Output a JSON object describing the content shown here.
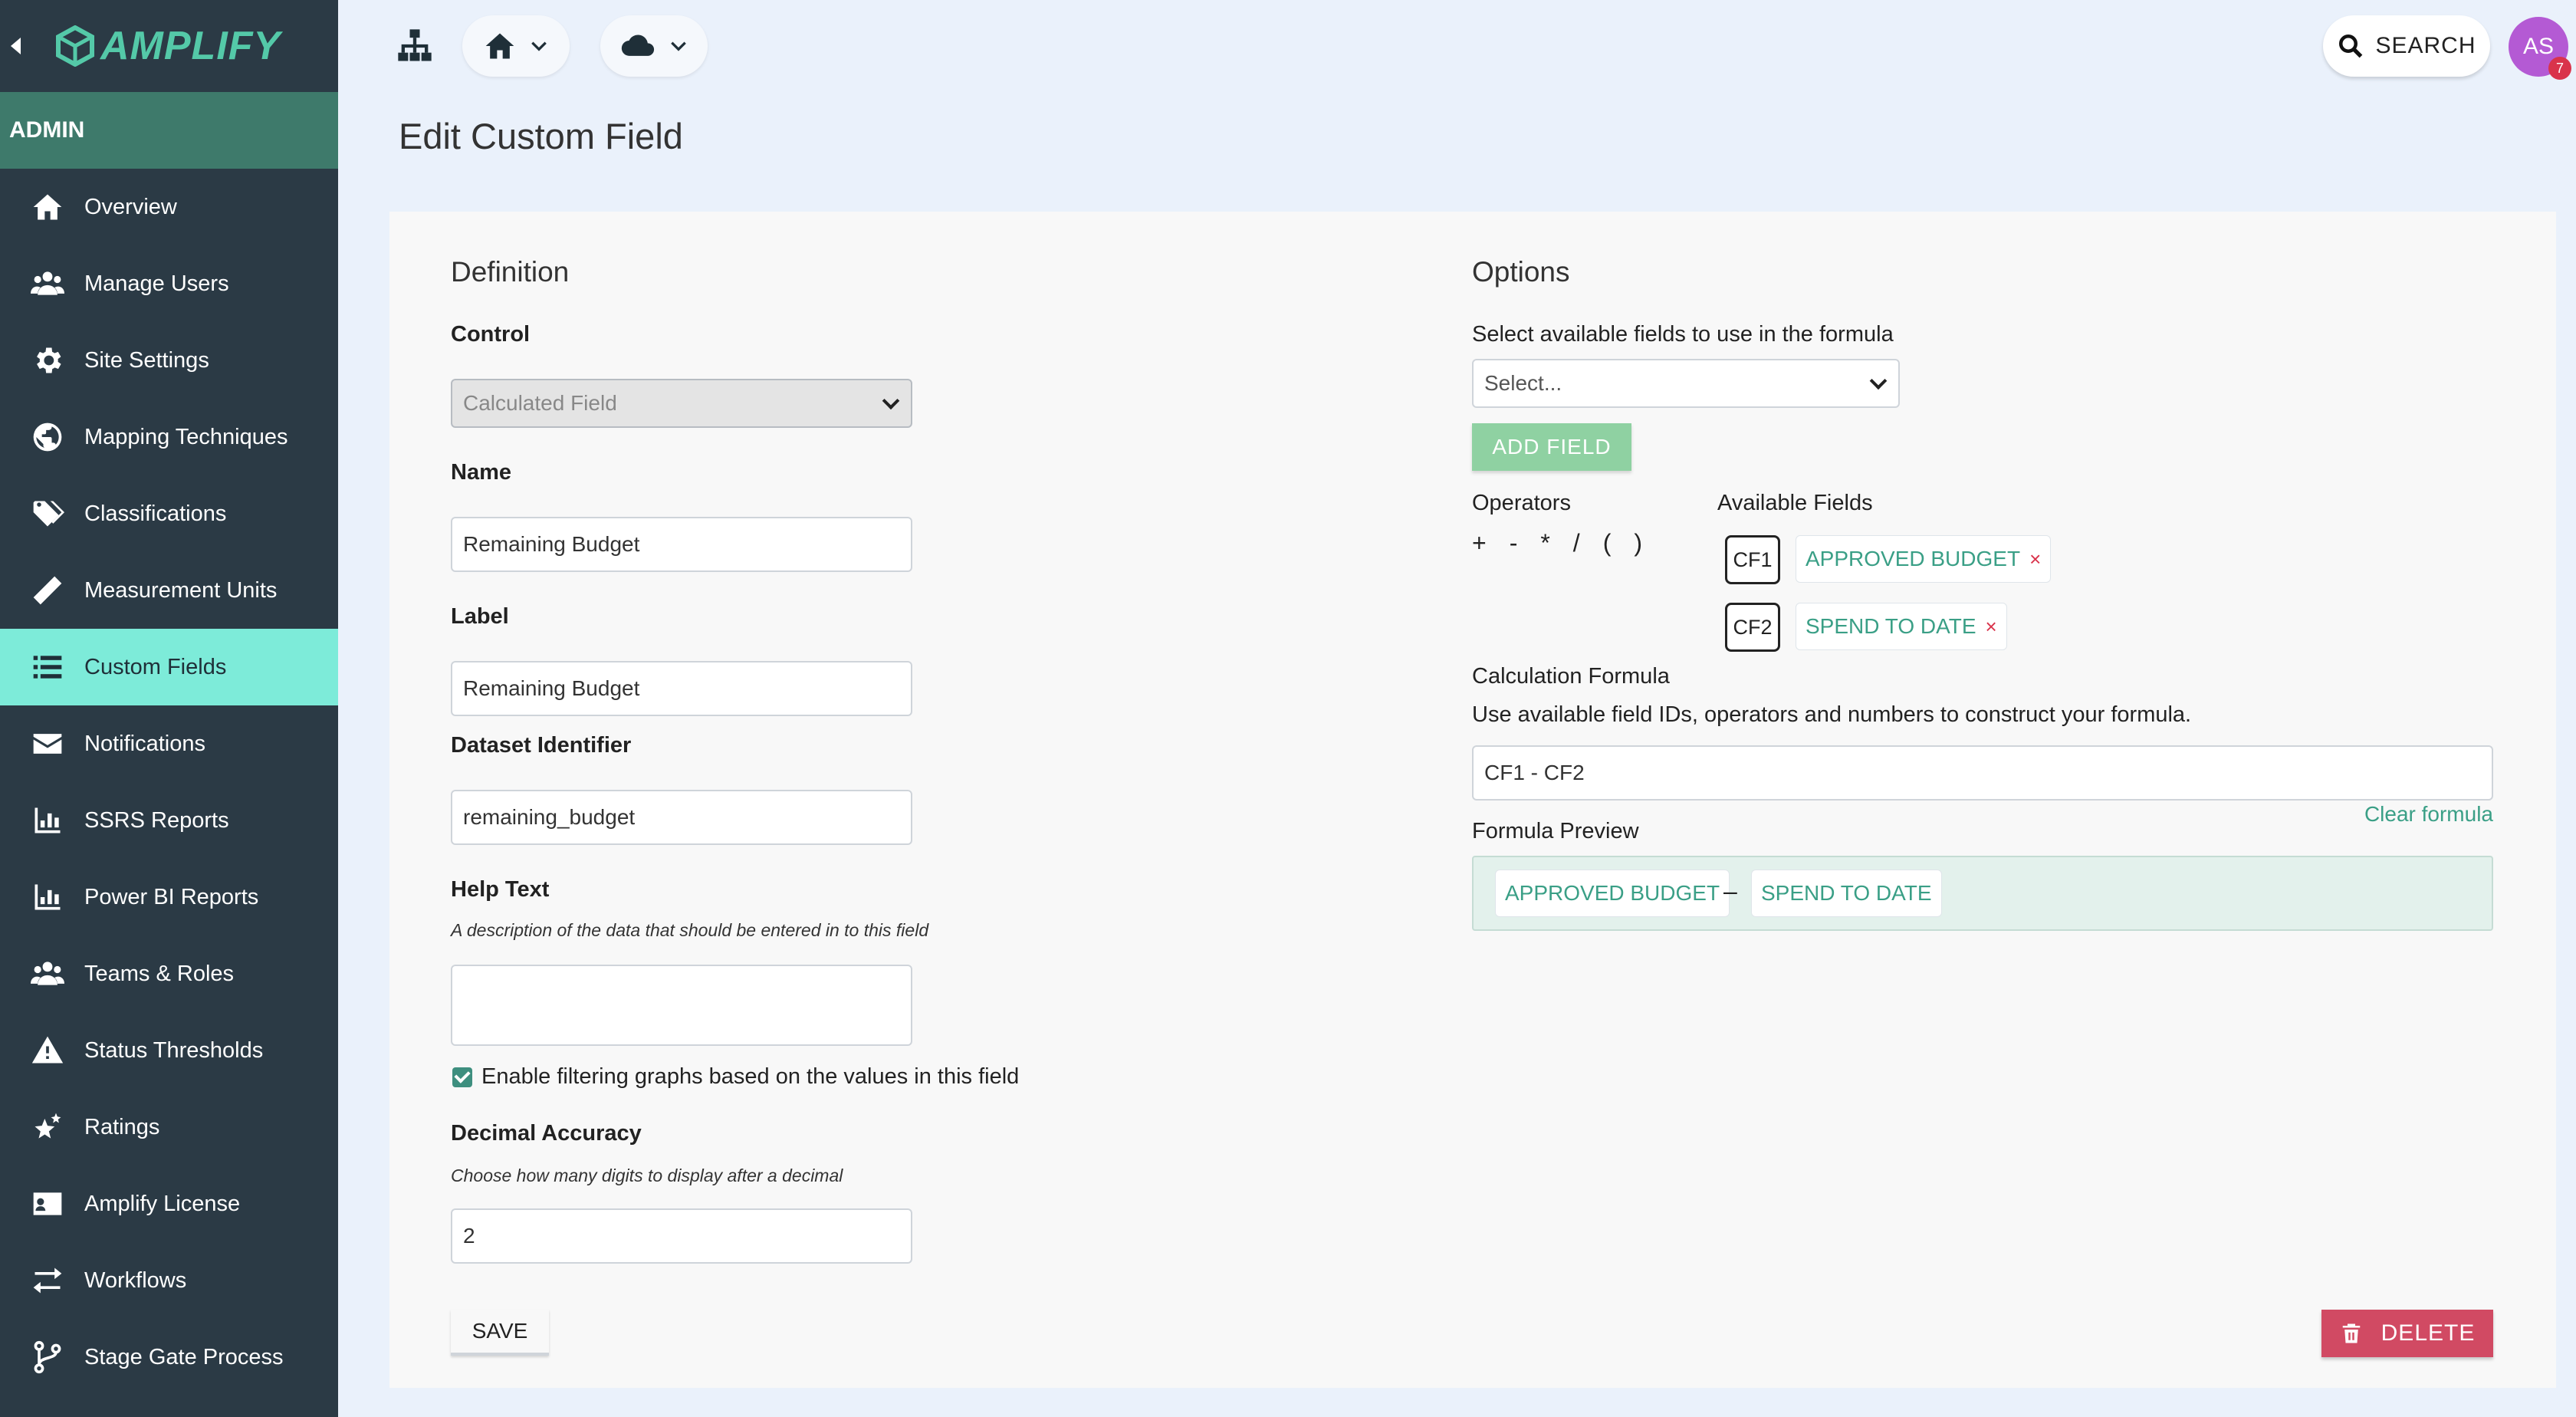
{
  "brand": {
    "name": "AMPLIFY"
  },
  "sidebar": {
    "section": "ADMIN",
    "items": [
      {
        "label": "Overview",
        "icon": "home-icon"
      },
      {
        "label": "Manage Users",
        "icon": "users-icon"
      },
      {
        "label": "Site Settings",
        "icon": "gear-icon"
      },
      {
        "label": "Mapping Techniques",
        "icon": "globe-icon"
      },
      {
        "label": "Classifications",
        "icon": "tags-icon"
      },
      {
        "label": "Measurement Units",
        "icon": "ruler-icon"
      },
      {
        "label": "Custom Fields",
        "icon": "list-icon",
        "active": true
      },
      {
        "label": "Notifications",
        "icon": "envelope-icon"
      },
      {
        "label": "SSRS Reports",
        "icon": "bar-chart-icon"
      },
      {
        "label": "Power BI Reports",
        "icon": "bar-chart-icon"
      },
      {
        "label": "Teams & Roles",
        "icon": "users-icon"
      },
      {
        "label": "Status Thresholds",
        "icon": "warning-icon"
      },
      {
        "label": "Ratings",
        "icon": "stars-icon"
      },
      {
        "label": "Amplify License",
        "icon": "id-card-icon"
      },
      {
        "label": "Workflows",
        "icon": "exchange-icon"
      },
      {
        "label": "Stage Gate Process",
        "icon": "branch-icon"
      }
    ]
  },
  "topbar": {
    "search_label": "SEARCH",
    "avatar_initials": "AS",
    "notification_count": "7"
  },
  "page": {
    "title": "Edit Custom Field"
  },
  "definition": {
    "title": "Definition",
    "control_label": "Control",
    "control_value": "Calculated Field",
    "name_label": "Name",
    "name_value": "Remaining Budget",
    "label_label": "Label",
    "label_value": "Remaining Budget",
    "dataset_label": "Dataset Identifier",
    "dataset_value": "remaining_budget",
    "help_label": "Help Text",
    "help_desc": "A description of the data that should be entered in to this field",
    "help_value": "",
    "filter_checkbox_label": "Enable filtering graphs based on the values in this field",
    "filter_checked": true,
    "decimal_label": "Decimal Accuracy",
    "decimal_desc": "Choose how many digits to display after a decimal",
    "decimal_value": "2",
    "save_label": "SAVE"
  },
  "options": {
    "title": "Options",
    "select_label": "Select available fields to use in the formula",
    "select_placeholder": "Select...",
    "add_field_label": "ADD FIELD",
    "operators_label": "Operators",
    "operators": [
      "+",
      "-",
      "*",
      "/",
      "(",
      ")"
    ],
    "available_fields_label": "Available Fields",
    "fields": [
      {
        "id": "CF1",
        "name": "APPROVED BUDGET"
      },
      {
        "id": "CF2",
        "name": "SPEND TO DATE"
      }
    ],
    "formula_label": "Calculation Formula",
    "formula_desc": "Use available field IDs, operators and numbers to construct your formula.",
    "formula_value": "CF1 - CF2",
    "clear_formula_label": "Clear formula",
    "preview_label": "Formula Preview",
    "preview_tokens": [
      "APPROVED BUDGET",
      "–",
      "SPEND TO DATE"
    ],
    "delete_label": "DELETE"
  },
  "colors": {
    "sidebar_bg": "#2b3a45",
    "admin_bar": "#3e7a6b",
    "active_item": "#7debd9",
    "accent_teal": "#3a9f86",
    "delete_red": "#d14a63",
    "add_field_green": "#8fd1a2"
  }
}
